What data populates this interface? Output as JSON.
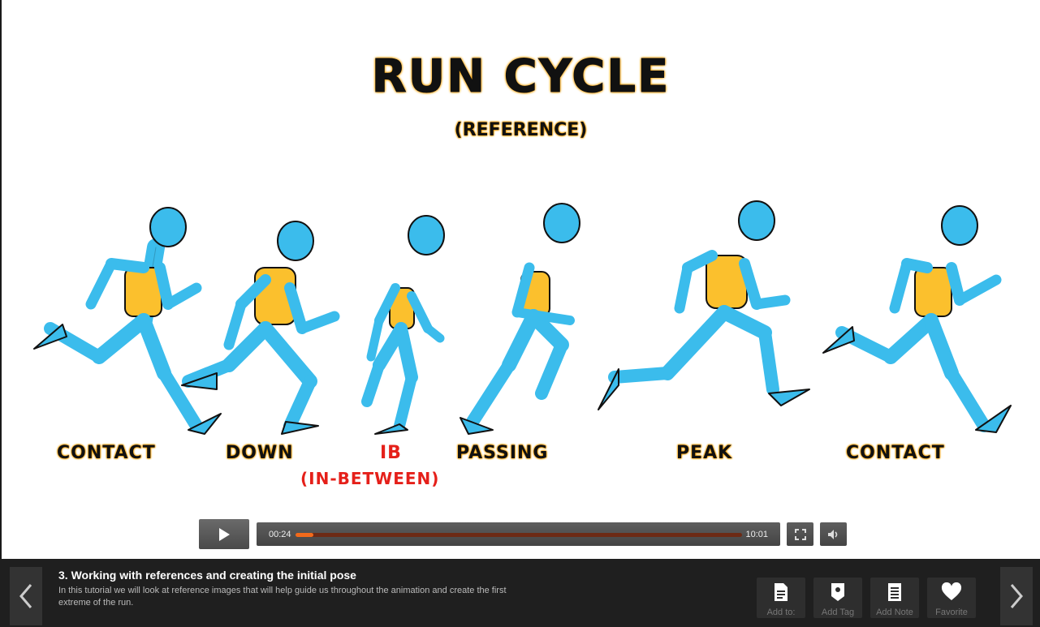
{
  "slide": {
    "title": "RUN CYCLE",
    "subtitle": "(REFERENCE)",
    "poses": [
      {
        "label": "CONTACT"
      },
      {
        "label": "DOWN"
      },
      {
        "label": "IB",
        "sub": "(IN-BETWEEN)"
      },
      {
        "label": "PASSING"
      },
      {
        "label": "PEAK"
      },
      {
        "label": "CONTACT"
      }
    ]
  },
  "player": {
    "current_time": "00:24",
    "duration": "10:01",
    "progress_fraction": 0.04
  },
  "lesson": {
    "title": "3. Working with references and creating the initial pose",
    "description": "In this tutorial we will look at reference images that will help guide us throughout the animation and create the first extreme of the run."
  },
  "actions": {
    "add_to": "Add to:",
    "add_tag": "Add Tag",
    "add_note": "Add Note",
    "favorite": "Favorite"
  },
  "colors": {
    "body": "#3bbcec",
    "torso": "#fbc02d",
    "accent": "#f26a1b",
    "label_red": "#e5201a"
  },
  "icons": {
    "prev": "chevron-left-icon",
    "next": "chevron-right-icon",
    "play": "play-icon",
    "fullscreen": "fullscreen-icon",
    "volume": "volume-icon"
  }
}
